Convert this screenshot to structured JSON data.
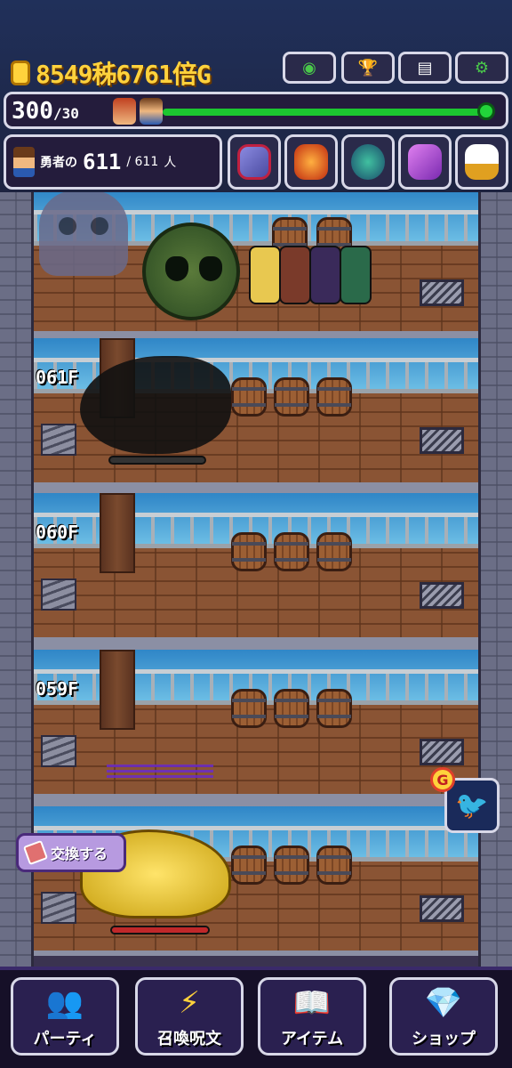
{
  "hud": {
    "gold": "8549秭6761倍G",
    "buttons": [
      {
        "name": "globe-button",
        "icon": "globe-icon",
        "glyph": "◉"
      },
      {
        "name": "trophy-button",
        "icon": "trophy-icon",
        "glyph": "🏆"
      },
      {
        "name": "log-button",
        "icon": "document-icon",
        "glyph": "▤"
      },
      {
        "name": "settings-button",
        "icon": "gear-icon",
        "glyph": "⚙"
      }
    ],
    "stamina_value": "300",
    "stamina_max": "/30",
    "stamina_fraction": 1.0,
    "heroes_label": "勇者の",
    "heroes_current": "611",
    "heroes_total": "/ 611",
    "heroes_unit": "人"
  },
  "floors": [
    {
      "label": ""
    },
    {
      "label": "061F"
    },
    {
      "label": "060F"
    },
    {
      "label": "059F"
    },
    {
      "label": ""
    }
  ],
  "side": {
    "exchange_label": "交換する",
    "g_badge": "G"
  },
  "nav": {
    "party": "パーティ",
    "summon": "召喚呪文",
    "items": "アイテム",
    "shop": "ショップ"
  },
  "colors": {
    "gold_text": "#ffd23c",
    "stamina_bar": "#1cc630",
    "hp_bar": "#c0282a"
  }
}
